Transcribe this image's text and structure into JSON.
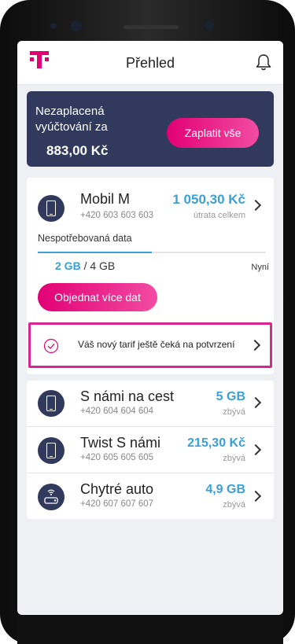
{
  "header": {
    "title": "Přehled"
  },
  "bill": {
    "label": "Nezaplacená vyúčtování za",
    "amount": "883,00 Kč",
    "pay_button": "Zaplatit vše"
  },
  "mobil_m": {
    "name": "Mobil M",
    "number": "+420 603 603 603",
    "value": "1 050,30 Kč",
    "value_sub": "útrata celkem",
    "data_title": "Nespotřebovaná data",
    "data_used": "2 GB",
    "data_total": "/ 4 GB",
    "data_when": "Nyní",
    "data_remaining_fraction": 0.5,
    "order_button": "Objednat více dat",
    "confirm_text": "Váš nový tarif ještě čeká na potvrzení"
  },
  "services": [
    {
      "name": "S námi na cest",
      "number": "+420 604 604 604",
      "value": "5 GB",
      "sub": "zbývá",
      "icon": "phone-icon"
    },
    {
      "name": "Twist S námi",
      "number": "+420 605 605 605",
      "value": "215,30 Kč",
      "sub": "zbývá",
      "icon": "phone-icon"
    },
    {
      "name": "Chytré auto",
      "number": "+420 607 607 607",
      "value": "4,9 GB",
      "sub": "zbývá",
      "icon": "car-wifi-icon"
    }
  ],
  "colors": {
    "brand": "#e20074",
    "navy": "#313a5c",
    "value_blue": "#3aa0d8",
    "highlight": "#d6268f"
  }
}
